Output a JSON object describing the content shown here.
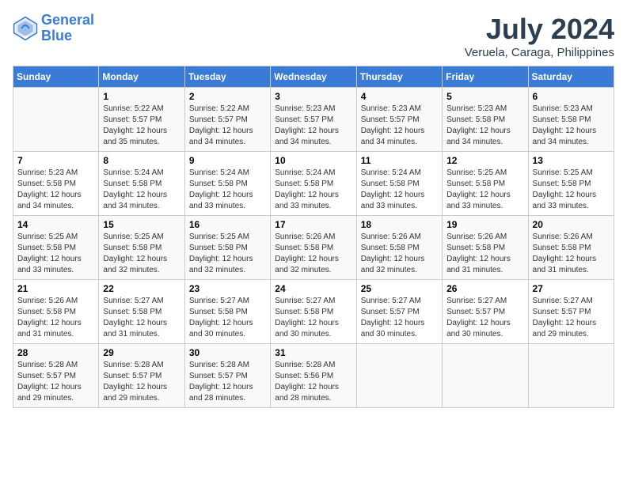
{
  "header": {
    "logo_line1": "General",
    "logo_line2": "Blue",
    "month_year": "July 2024",
    "location": "Veruela, Caraga, Philippines"
  },
  "days_of_week": [
    "Sunday",
    "Monday",
    "Tuesday",
    "Wednesday",
    "Thursday",
    "Friday",
    "Saturday"
  ],
  "weeks": [
    [
      {
        "day": "",
        "info": ""
      },
      {
        "day": "1",
        "info": "Sunrise: 5:22 AM\nSunset: 5:57 PM\nDaylight: 12 hours\nand 35 minutes."
      },
      {
        "day": "2",
        "info": "Sunrise: 5:22 AM\nSunset: 5:57 PM\nDaylight: 12 hours\nand 34 minutes."
      },
      {
        "day": "3",
        "info": "Sunrise: 5:23 AM\nSunset: 5:57 PM\nDaylight: 12 hours\nand 34 minutes."
      },
      {
        "day": "4",
        "info": "Sunrise: 5:23 AM\nSunset: 5:57 PM\nDaylight: 12 hours\nand 34 minutes."
      },
      {
        "day": "5",
        "info": "Sunrise: 5:23 AM\nSunset: 5:58 PM\nDaylight: 12 hours\nand 34 minutes."
      },
      {
        "day": "6",
        "info": "Sunrise: 5:23 AM\nSunset: 5:58 PM\nDaylight: 12 hours\nand 34 minutes."
      }
    ],
    [
      {
        "day": "7",
        "info": "Sunrise: 5:23 AM\nSunset: 5:58 PM\nDaylight: 12 hours\nand 34 minutes."
      },
      {
        "day": "8",
        "info": "Sunrise: 5:24 AM\nSunset: 5:58 PM\nDaylight: 12 hours\nand 34 minutes."
      },
      {
        "day": "9",
        "info": "Sunrise: 5:24 AM\nSunset: 5:58 PM\nDaylight: 12 hours\nand 33 minutes."
      },
      {
        "day": "10",
        "info": "Sunrise: 5:24 AM\nSunset: 5:58 PM\nDaylight: 12 hours\nand 33 minutes."
      },
      {
        "day": "11",
        "info": "Sunrise: 5:24 AM\nSunset: 5:58 PM\nDaylight: 12 hours\nand 33 minutes."
      },
      {
        "day": "12",
        "info": "Sunrise: 5:25 AM\nSunset: 5:58 PM\nDaylight: 12 hours\nand 33 minutes."
      },
      {
        "day": "13",
        "info": "Sunrise: 5:25 AM\nSunset: 5:58 PM\nDaylight: 12 hours\nand 33 minutes."
      }
    ],
    [
      {
        "day": "14",
        "info": "Sunrise: 5:25 AM\nSunset: 5:58 PM\nDaylight: 12 hours\nand 33 minutes."
      },
      {
        "day": "15",
        "info": "Sunrise: 5:25 AM\nSunset: 5:58 PM\nDaylight: 12 hours\nand 32 minutes."
      },
      {
        "day": "16",
        "info": "Sunrise: 5:25 AM\nSunset: 5:58 PM\nDaylight: 12 hours\nand 32 minutes."
      },
      {
        "day": "17",
        "info": "Sunrise: 5:26 AM\nSunset: 5:58 PM\nDaylight: 12 hours\nand 32 minutes."
      },
      {
        "day": "18",
        "info": "Sunrise: 5:26 AM\nSunset: 5:58 PM\nDaylight: 12 hours\nand 32 minutes."
      },
      {
        "day": "19",
        "info": "Sunrise: 5:26 AM\nSunset: 5:58 PM\nDaylight: 12 hours\nand 31 minutes."
      },
      {
        "day": "20",
        "info": "Sunrise: 5:26 AM\nSunset: 5:58 PM\nDaylight: 12 hours\nand 31 minutes."
      }
    ],
    [
      {
        "day": "21",
        "info": "Sunrise: 5:26 AM\nSunset: 5:58 PM\nDaylight: 12 hours\nand 31 minutes."
      },
      {
        "day": "22",
        "info": "Sunrise: 5:27 AM\nSunset: 5:58 PM\nDaylight: 12 hours\nand 31 minutes."
      },
      {
        "day": "23",
        "info": "Sunrise: 5:27 AM\nSunset: 5:58 PM\nDaylight: 12 hours\nand 30 minutes."
      },
      {
        "day": "24",
        "info": "Sunrise: 5:27 AM\nSunset: 5:58 PM\nDaylight: 12 hours\nand 30 minutes."
      },
      {
        "day": "25",
        "info": "Sunrise: 5:27 AM\nSunset: 5:57 PM\nDaylight: 12 hours\nand 30 minutes."
      },
      {
        "day": "26",
        "info": "Sunrise: 5:27 AM\nSunset: 5:57 PM\nDaylight: 12 hours\nand 30 minutes."
      },
      {
        "day": "27",
        "info": "Sunrise: 5:27 AM\nSunset: 5:57 PM\nDaylight: 12 hours\nand 29 minutes."
      }
    ],
    [
      {
        "day": "28",
        "info": "Sunrise: 5:28 AM\nSunset: 5:57 PM\nDaylight: 12 hours\nand 29 minutes."
      },
      {
        "day": "29",
        "info": "Sunrise: 5:28 AM\nSunset: 5:57 PM\nDaylight: 12 hours\nand 29 minutes."
      },
      {
        "day": "30",
        "info": "Sunrise: 5:28 AM\nSunset: 5:57 PM\nDaylight: 12 hours\nand 28 minutes."
      },
      {
        "day": "31",
        "info": "Sunrise: 5:28 AM\nSunset: 5:56 PM\nDaylight: 12 hours\nand 28 minutes."
      },
      {
        "day": "",
        "info": ""
      },
      {
        "day": "",
        "info": ""
      },
      {
        "day": "",
        "info": ""
      }
    ]
  ]
}
